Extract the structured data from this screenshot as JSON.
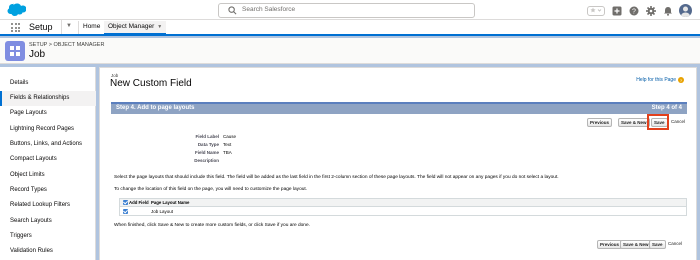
{
  "header": {
    "search_placeholder": "Search Salesforce"
  },
  "appnav": {
    "app_name": "Setup",
    "tabs": [
      "Home",
      "Object Manager"
    ]
  },
  "page_header": {
    "breadcrumb": "SETUP > OBJECT MANAGER",
    "title": "Job"
  },
  "sidebar": {
    "items": [
      "Details",
      "Fields & Relationships",
      "Page Layouts",
      "Lightning Record Pages",
      "Buttons, Links, and Actions",
      "Compact Layouts",
      "Object Limits",
      "Record Types",
      "Related Lookup Filters",
      "Search Layouts",
      "Triggers",
      "Validation Rules"
    ],
    "active_index": 1
  },
  "main": {
    "object_label": "Job",
    "title": "New Custom Field",
    "help_link": "Help for this Page",
    "step_title": "Step 4. Add to page layouts",
    "step_number": "Step 4 of 4",
    "buttons": {
      "previous": "Previous",
      "save_new": "Save & New",
      "save": "Save",
      "cancel": "Cancel"
    },
    "fields": [
      {
        "label": "Field Label",
        "value": "Cause"
      },
      {
        "label": "Data Type",
        "value": "Text"
      },
      {
        "label": "Field Name",
        "value": "TBA"
      },
      {
        "label": "Description",
        "value": ""
      }
    ],
    "instruction_1": "Select the page layouts that should include this field. The field will be added as the last field in the first 2-column section of these page layouts. The field will not appear on any pages if you do not select a layout.",
    "instruction_2": "To change the location of this field on the page, you will need to customize the page layout.",
    "layout_table": {
      "headers": [
        "Add Field",
        "Page Layout Name"
      ],
      "rows": [
        {
          "checked": true,
          "name": "Job Layout"
        }
      ]
    },
    "footer_text": "When finished, click Save & New to create more custom fields, or click Save if you are done."
  }
}
